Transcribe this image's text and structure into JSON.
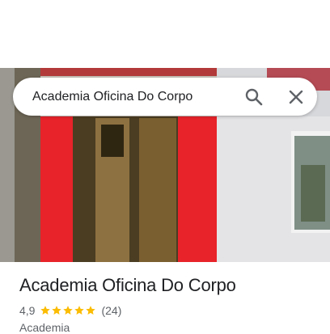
{
  "search": {
    "query": "Academia Oficina Do Corpo",
    "search_icon": "search-icon",
    "close_icon": "close-icon"
  },
  "place": {
    "name": "Academia Oficina Do Corpo",
    "rating": "4,9",
    "stars_filled": 5,
    "review_count": "(24)",
    "category": "Academia"
  },
  "colors": {
    "star": "#fbbc04",
    "wall_red": "#e8232a",
    "text_primary": "#202124",
    "text_secondary": "#5f6368"
  }
}
